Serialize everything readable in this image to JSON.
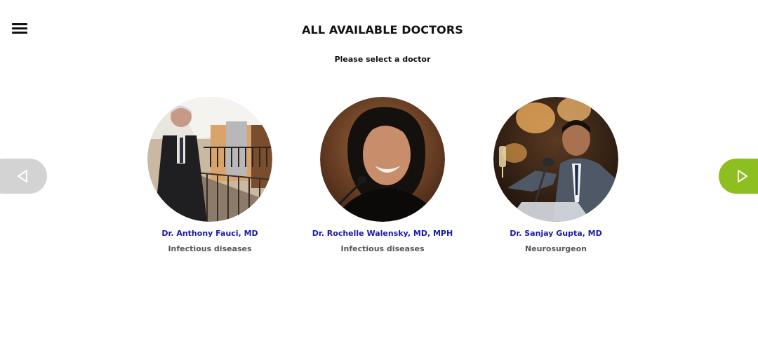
{
  "header": {
    "title": "ALL AVAILABLE DOCTORS",
    "subtitle": "Please select a doctor",
    "menu_icon": "hamburger-menu-icon"
  },
  "carousel": {
    "prev_icon": "triangle-left-outline-icon",
    "next_icon": "triangle-right-outline-icon",
    "prev_color": "#d3d3d3",
    "next_color": "#8cbf1f"
  },
  "doctors": [
    {
      "name": "Dr. Anthony Fauci, MD",
      "specialty": "Infectious diseases"
    },
    {
      "name": "Dr. Rochelle Walensky, MD, MPH",
      "specialty": "Infectious diseases"
    },
    {
      "name": "Dr. Sanjay Gupta, MD",
      "specialty": "Neurosurgeon"
    }
  ],
  "colors": {
    "doctor_name": "#1a1aa6",
    "specialty": "#555555",
    "title": "#111111"
  }
}
